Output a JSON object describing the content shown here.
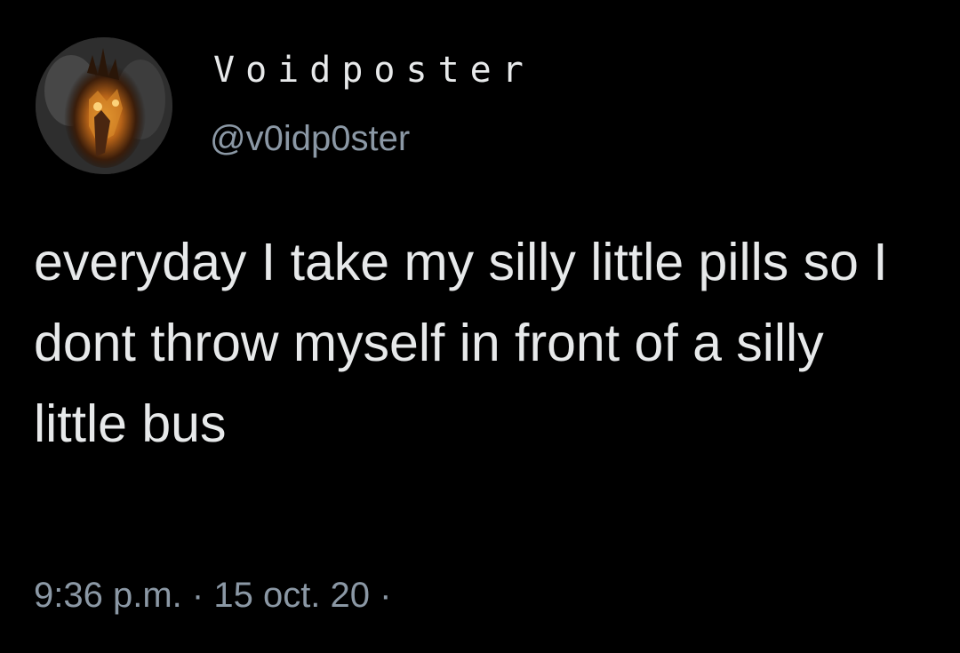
{
  "author": {
    "display_name": "Voidposter",
    "handle": "@v0idp0ster",
    "avatar": "burning-face-avatar-icon"
  },
  "tweet": {
    "text": "everyday I take my silly little pills so I dont throw myself in front of a silly little bus",
    "time": "9:36 p.m.",
    "separator": "·",
    "date": "15 oct. 20"
  },
  "colors": {
    "background": "#000000",
    "primary_text": "#e7e9ea",
    "secondary_text": "#8b98a5"
  }
}
